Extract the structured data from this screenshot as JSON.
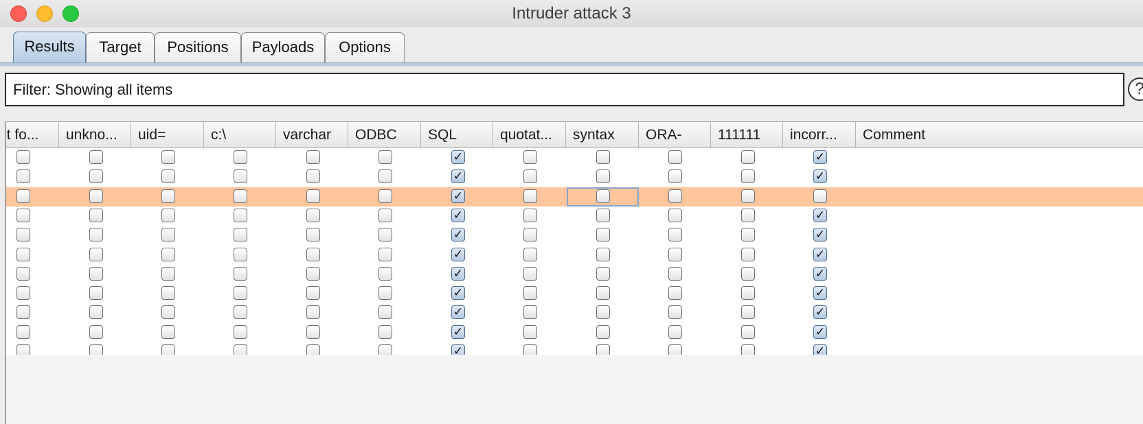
{
  "window": {
    "title": "Intruder attack 3"
  },
  "tabs": [
    {
      "label": "Results",
      "active": true
    },
    {
      "label": "Target",
      "active": false
    },
    {
      "label": "Positions",
      "active": false
    },
    {
      "label": "Payloads",
      "active": false
    },
    {
      "label": "Options",
      "active": false
    }
  ],
  "filter": {
    "label": "Filter: Showing all items"
  },
  "help": {
    "glyph": "?"
  },
  "table": {
    "columns": [
      "ot fo...",
      "unkno...",
      "uid=",
      "c:\\",
      "varchar",
      "ODBC",
      "SQL",
      "quotat...",
      "syntax",
      "ORA-",
      "111111",
      "incorr...",
      "Comment"
    ],
    "rows": [
      [
        false,
        false,
        false,
        false,
        false,
        false,
        true,
        false,
        false,
        false,
        false,
        true
      ],
      [
        false,
        false,
        false,
        false,
        false,
        false,
        true,
        false,
        false,
        false,
        false,
        true
      ],
      [
        false,
        false,
        false,
        false,
        false,
        false,
        true,
        false,
        false,
        false,
        false,
        false
      ],
      [
        false,
        false,
        false,
        false,
        false,
        false,
        true,
        false,
        false,
        false,
        false,
        true
      ],
      [
        false,
        false,
        false,
        false,
        false,
        false,
        true,
        false,
        false,
        false,
        false,
        true
      ],
      [
        false,
        false,
        false,
        false,
        false,
        false,
        true,
        false,
        false,
        false,
        false,
        true
      ],
      [
        false,
        false,
        false,
        false,
        false,
        false,
        true,
        false,
        false,
        false,
        false,
        true
      ],
      [
        false,
        false,
        false,
        false,
        false,
        false,
        true,
        false,
        false,
        false,
        false,
        true
      ],
      [
        false,
        false,
        false,
        false,
        false,
        false,
        true,
        false,
        false,
        false,
        false,
        true
      ],
      [
        false,
        false,
        false,
        false,
        false,
        false,
        true,
        false,
        false,
        false,
        false,
        true
      ],
      [
        false,
        false,
        false,
        false,
        false,
        false,
        true,
        false,
        false,
        false,
        false,
        true
      ]
    ],
    "selected_row": 2,
    "check_glyph": "✓",
    "colors": {
      "selected_row": "#ffc59c",
      "checkbox_checked": "#b5c9e0",
      "active_tab": "#b8cce3"
    }
  }
}
